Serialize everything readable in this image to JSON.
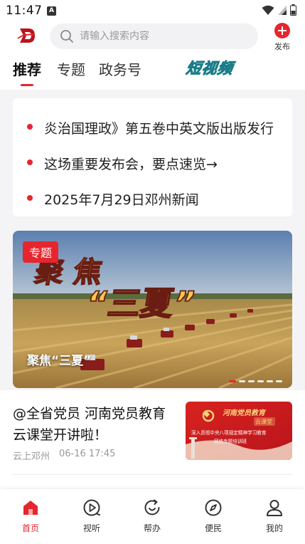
{
  "status_bar": {
    "time": "11:47",
    "notification_icon": "A"
  },
  "header": {
    "search_placeholder": "请输入搜索内容",
    "publish_label": "发布"
  },
  "tabs": [
    {
      "label": "推荐",
      "active": true
    },
    {
      "label": "专题",
      "active": false
    },
    {
      "label": "政务号",
      "active": false
    },
    {
      "label": "短视频",
      "active": false
    }
  ],
  "headlines": [
    "炎治国理政》第五卷中英文版出版发行",
    "这场重要发布会，要点速览→",
    "2025年7月29日邓州新闻"
  ],
  "banner": {
    "tag": "专题",
    "headline_part1": "聚 焦",
    "headline_part2": "“三夏”",
    "caption": "聚焦“三夏”",
    "slide_count": 6,
    "active_slide": 1
  },
  "news": {
    "title": "@全省党员 河南党员教育云课堂开讲啦！",
    "source": "云上邓州",
    "time": "06-16 17:45",
    "thumb_title": "河南党员教育",
    "thumb_badge": "云课堂",
    "thumb_subtitle": "深入贯彻中央八项规定精神学习教育",
    "thumb_subtitle2": "网络专题培训班"
  },
  "bottom_nav": [
    {
      "label": "首页",
      "icon": "home-icon",
      "active": true
    },
    {
      "label": "视听",
      "icon": "play-icon",
      "active": false
    },
    {
      "label": "帮办",
      "icon": "refresh-icon",
      "active": false
    },
    {
      "label": "便民",
      "icon": "compass-icon",
      "active": false
    },
    {
      "label": "我的",
      "icon": "user-icon",
      "active": false
    }
  ],
  "colors": {
    "accent": "#e6262e",
    "background": "#f4f4f6",
    "short_video": "#7fe7ee"
  }
}
